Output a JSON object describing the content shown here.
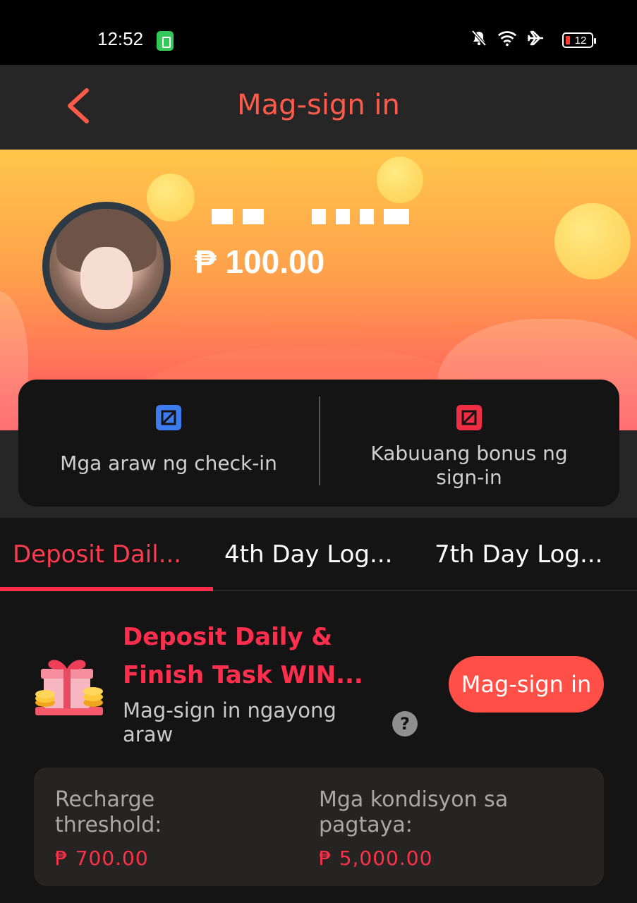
{
  "status_bar": {
    "time": "12:52",
    "battery": "12",
    "icons": [
      "charging-icon",
      "mute-icon",
      "wifi-icon",
      "airplane-icon",
      "battery-icon"
    ]
  },
  "header": {
    "title": "Mag-sign in",
    "accent_color": "#ff5a4a"
  },
  "profile": {
    "balance": "₱ 100.00"
  },
  "stats": {
    "checkin_days_label": "Mga araw ng check-in",
    "total_bonus_label": "Kabuuang bonus ng sign-in",
    "checkin_icon_color": "#3d7cf0",
    "bonus_icon_color": "#ef2e45"
  },
  "tabs": [
    {
      "label": "Deposit Dail...",
      "active": true
    },
    {
      "label": "4th Day Log...",
      "active": false
    },
    {
      "label": "7th Day Log...",
      "active": false
    }
  ],
  "task": {
    "title": "Deposit Daily & Finish Task WIN...",
    "subtitle": "Mag-sign in ngayong araw",
    "button_label": "Mag-sign in",
    "help_label": "?"
  },
  "conditions": {
    "recharge_label": "Recharge threshold:",
    "recharge_value": "₱ 700.00",
    "wager_label": "Mga kondisyon sa pagtaya:",
    "wager_value": "₱ 5,000.00"
  }
}
